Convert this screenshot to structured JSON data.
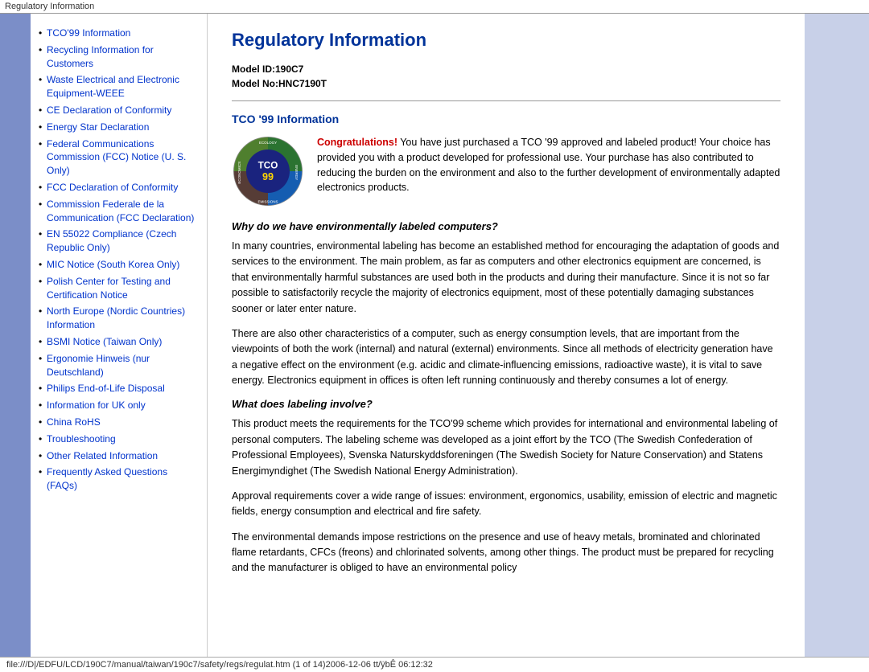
{
  "titleBar": {
    "text": "Regulatory Information"
  },
  "sidebar": {
    "items": [
      {
        "label": "TCO'99 Information",
        "href": "#"
      },
      {
        "label": "Recycling Information for Customers",
        "href": "#"
      },
      {
        "label": "Waste Electrical and Electronic Equipment-WEEE",
        "href": "#"
      },
      {
        "label": "CE Declaration of Conformity",
        "href": "#"
      },
      {
        "label": "Energy Star Declaration",
        "href": "#"
      },
      {
        "label": "Federal Communications Commission (FCC) Notice (U. S. Only)",
        "href": "#"
      },
      {
        "label": "FCC Declaration of Conformity",
        "href": "#"
      },
      {
        "label": "Commission Federale de la Communication (FCC Declaration)",
        "href": "#"
      },
      {
        "label": "EN 55022 Compliance (Czech Republic Only)",
        "href": "#"
      },
      {
        "label": "MIC Notice (South Korea Only)",
        "href": "#"
      },
      {
        "label": "Polish Center for Testing and Certification Notice",
        "href": "#"
      },
      {
        "label": "North Europe (Nordic Countries) Information",
        "href": "#"
      },
      {
        "label": "BSMI Notice (Taiwan Only)",
        "href": "#"
      },
      {
        "label": "Ergonomie Hinweis (nur Deutschland)",
        "href": "#"
      },
      {
        "label": "Philips End-of-Life Disposal",
        "href": "#"
      },
      {
        "label": "Information for UK only",
        "href": "#"
      },
      {
        "label": "China RoHS",
        "href": "#"
      },
      {
        "label": "Troubleshooting",
        "href": "#"
      },
      {
        "label": "Other Related Information",
        "href": "#"
      },
      {
        "label": "Frequently Asked Questions (FAQs)",
        "href": "#"
      }
    ]
  },
  "main": {
    "title": "Regulatory Information",
    "modelId": "Model ID:190C7",
    "modelNo": "Model No:HNC7190T",
    "sectionTitle": "TCO '99 Information",
    "congratsLabel": "Congratulations!",
    "introText": " You have just purchased a TCO '99 approved and labeled product! Your choice has provided you with a product developed for professional use. Your purchase has also contributed to reducing the burden on the environment and also to the further development of environmentally adapted electronics products.",
    "subheading1": "Why do we have environmentally labeled computers?",
    "para1": "In many countries, environmental labeling has become an established method for encouraging the adaptation of goods and services to the environment. The main problem, as far as computers and other electronics equipment are concerned, is that environmentally harmful substances are used both in the products and during their manufacture. Since it is not so far possible to satisfactorily recycle the majority of electronics equipment, most of these potentially damaging substances sooner or later enter nature.",
    "para2": "There are also other characteristics of a computer, such as energy consumption levels, that are important from the viewpoints of both the work (internal) and natural (external) environments. Since all methods of electricity generation have a negative effect on the environment (e.g. acidic and climate-influencing emissions, radioactive waste), it is vital to save energy. Electronics equipment in offices is often left running continuously and thereby consumes a lot of energy.",
    "subheading2": "What does labeling involve?",
    "para3": "This product meets the requirements for the TCO'99 scheme which provides for international and environmental labeling of personal computers. The labeling scheme was developed as a joint effort by the TCO (The Swedish Confederation of Professional Employees), Svenska Naturskyddsforeningen (The Swedish Society for Nature Conservation) and Statens Energimyndighet (The Swedish National Energy Administration).",
    "para4": "Approval requirements cover a wide range of issues: environment, ergonomics, usability, emission of electric and magnetic fields, energy consumption and electrical and fire safety.",
    "para5": "The environmental demands impose restrictions on the presence and use of heavy metals, brominated and chlorinated flame retardants, CFCs (freons) and chlorinated solvents, among other things. The product must be prepared for recycling and the manufacturer is obliged to have an environmental policy"
  },
  "bottomBar": {
    "text": "file:///D|/EDFU/LCD/190C7/manual/taiwan/190c7/safety/regs/regulat.htm (1 of 14)2006-12-06 tt/ÿbÊ 06:12:32"
  }
}
